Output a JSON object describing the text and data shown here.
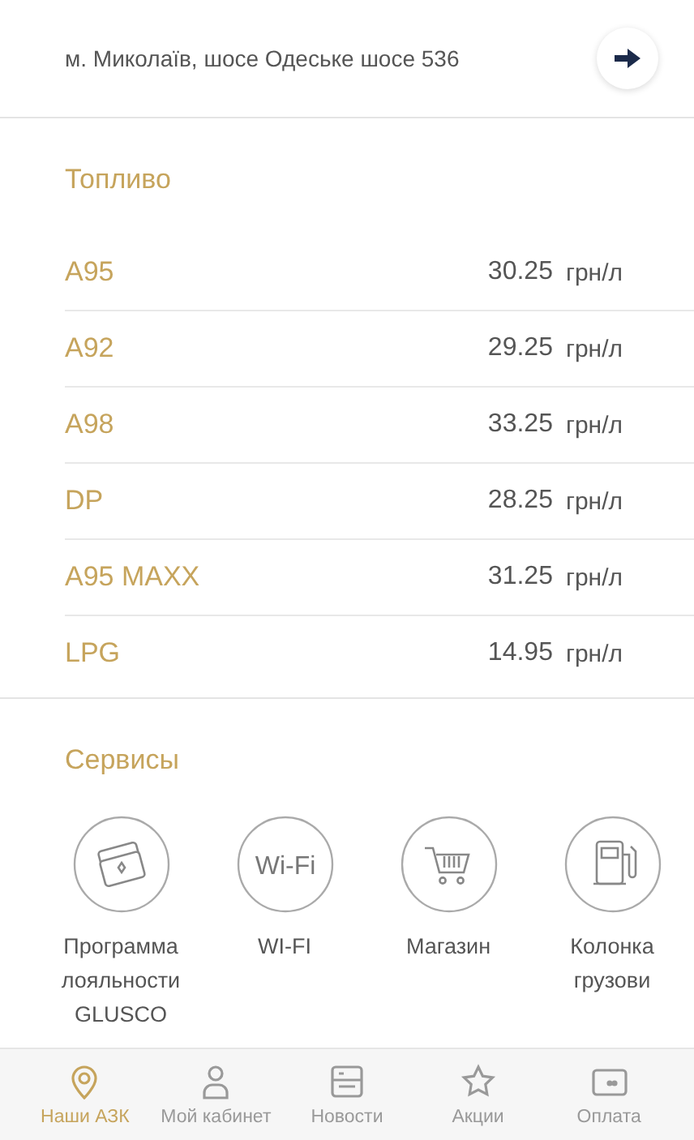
{
  "header": {
    "address": "м. Миколаїв, шосе Одеське шосе 536"
  },
  "fuel": {
    "title": "Топливо",
    "rows": [
      {
        "name": "A95",
        "price": "30.25",
        "unit": "грн/л"
      },
      {
        "name": "A92",
        "price": "29.25",
        "unit": "грн/л"
      },
      {
        "name": "A98",
        "price": "33.25",
        "unit": "грн/л"
      },
      {
        "name": "DP",
        "price": "28.25",
        "unit": "грн/л"
      },
      {
        "name": "A95 MAXX",
        "price": "31.25",
        "unit": "грн/л"
      },
      {
        "name": "LPG",
        "price": "14.95",
        "unit": "грн/л"
      }
    ]
  },
  "services": {
    "title": "Сервисы",
    "items": [
      {
        "kind": "cards",
        "lines": [
          "Программа",
          "лояльности",
          "GLUSCO"
        ]
      },
      {
        "kind": "wifi",
        "icon_text": "Wi-Fi",
        "lines": [
          "WI-FI"
        ]
      },
      {
        "kind": "cart",
        "lines": [
          "Магазин"
        ]
      },
      {
        "kind": "pump",
        "lines": [
          "Колонка",
          "грузови"
        ]
      }
    ]
  },
  "tabs": [
    {
      "kind": "pin",
      "label": "Наши АЗК",
      "selected": true
    },
    {
      "kind": "person",
      "label": "Мой кабинет",
      "selected": false
    },
    {
      "kind": "news",
      "label": "Новости",
      "selected": false
    },
    {
      "kind": "star",
      "label": "Акции",
      "selected": false
    },
    {
      "kind": "card",
      "label": "Оплата",
      "selected": false
    }
  ]
}
